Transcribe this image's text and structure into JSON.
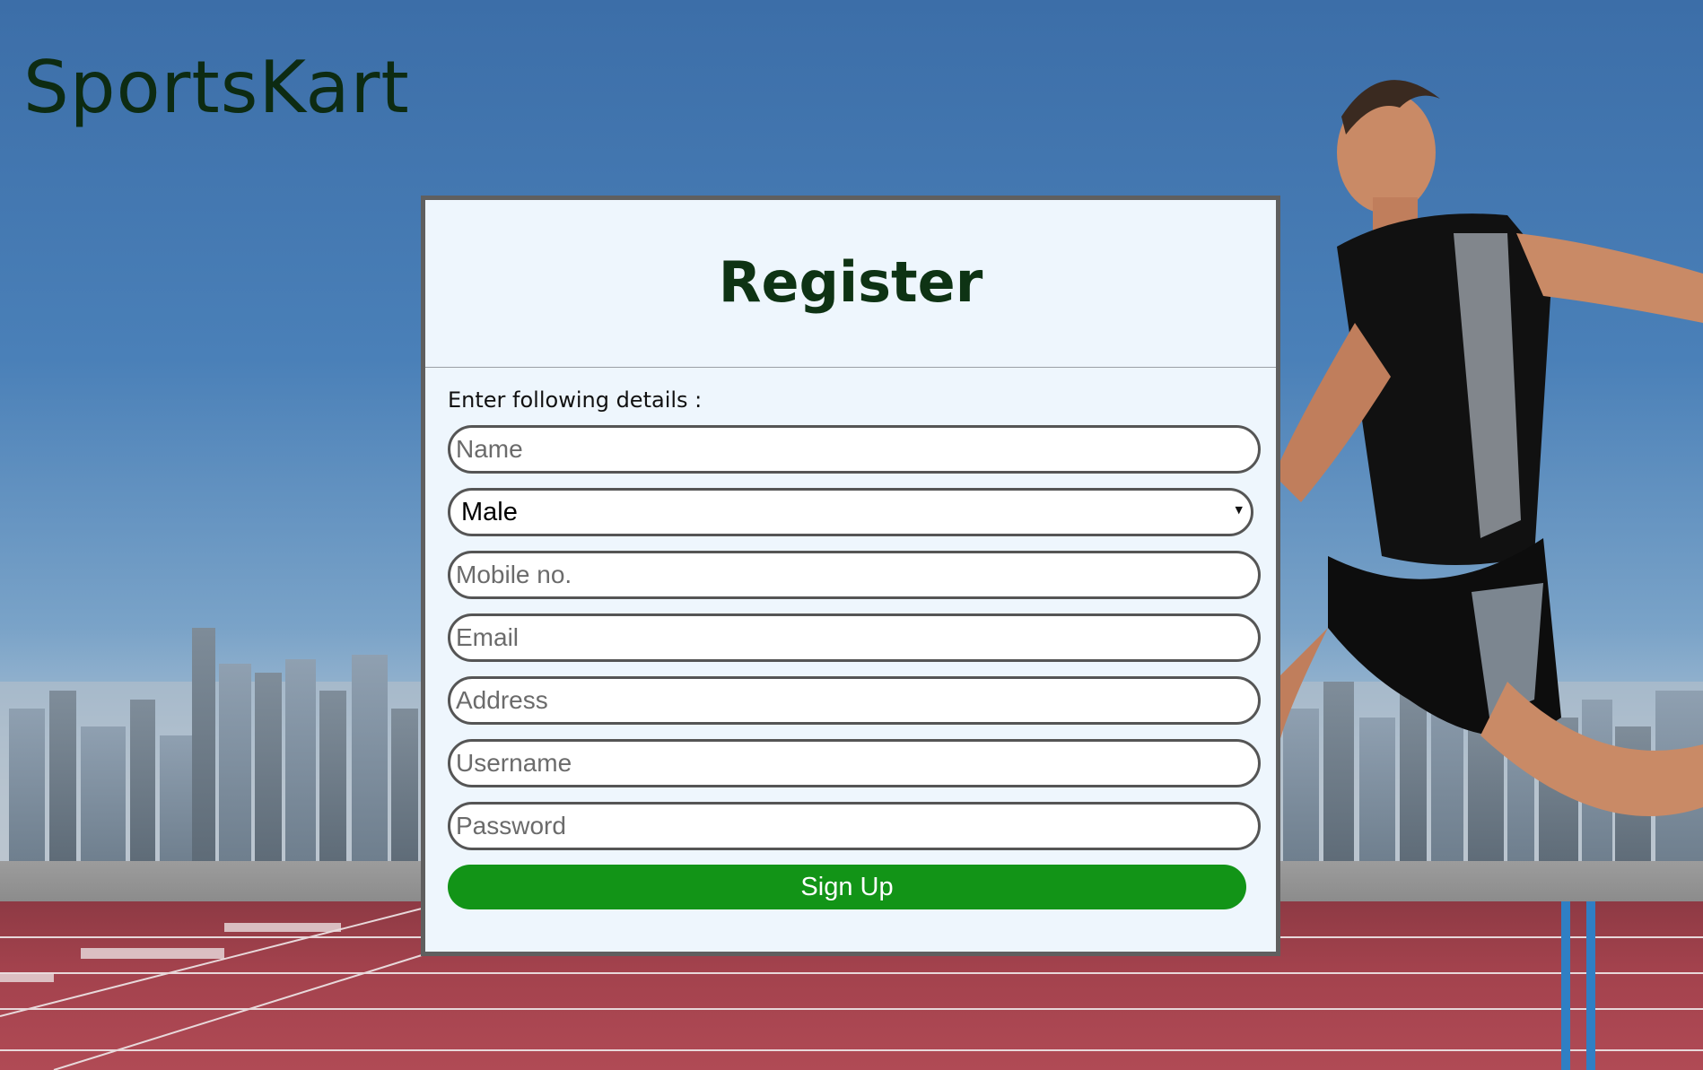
{
  "brand": {
    "title": "SportsKart"
  },
  "register": {
    "title": "Register",
    "instructions": "Enter following details :",
    "name_placeholder": "Name",
    "gender_selected": "Male",
    "mobile_placeholder": "Mobile no.",
    "email_placeholder": "Email",
    "address_placeholder": "Address",
    "username_placeholder": "Username",
    "password_placeholder": "Password",
    "signup_label": "Sign Up"
  },
  "colors": {
    "brand_text": "#0d2b12",
    "card_background": "#eef6fd",
    "card_border": "#5f5f5f",
    "button_green": "#129417",
    "sky_blue": "#3f74ab",
    "track_red": "#a3424d"
  },
  "icons": {
    "select_arrow": "caret-down-icon"
  }
}
